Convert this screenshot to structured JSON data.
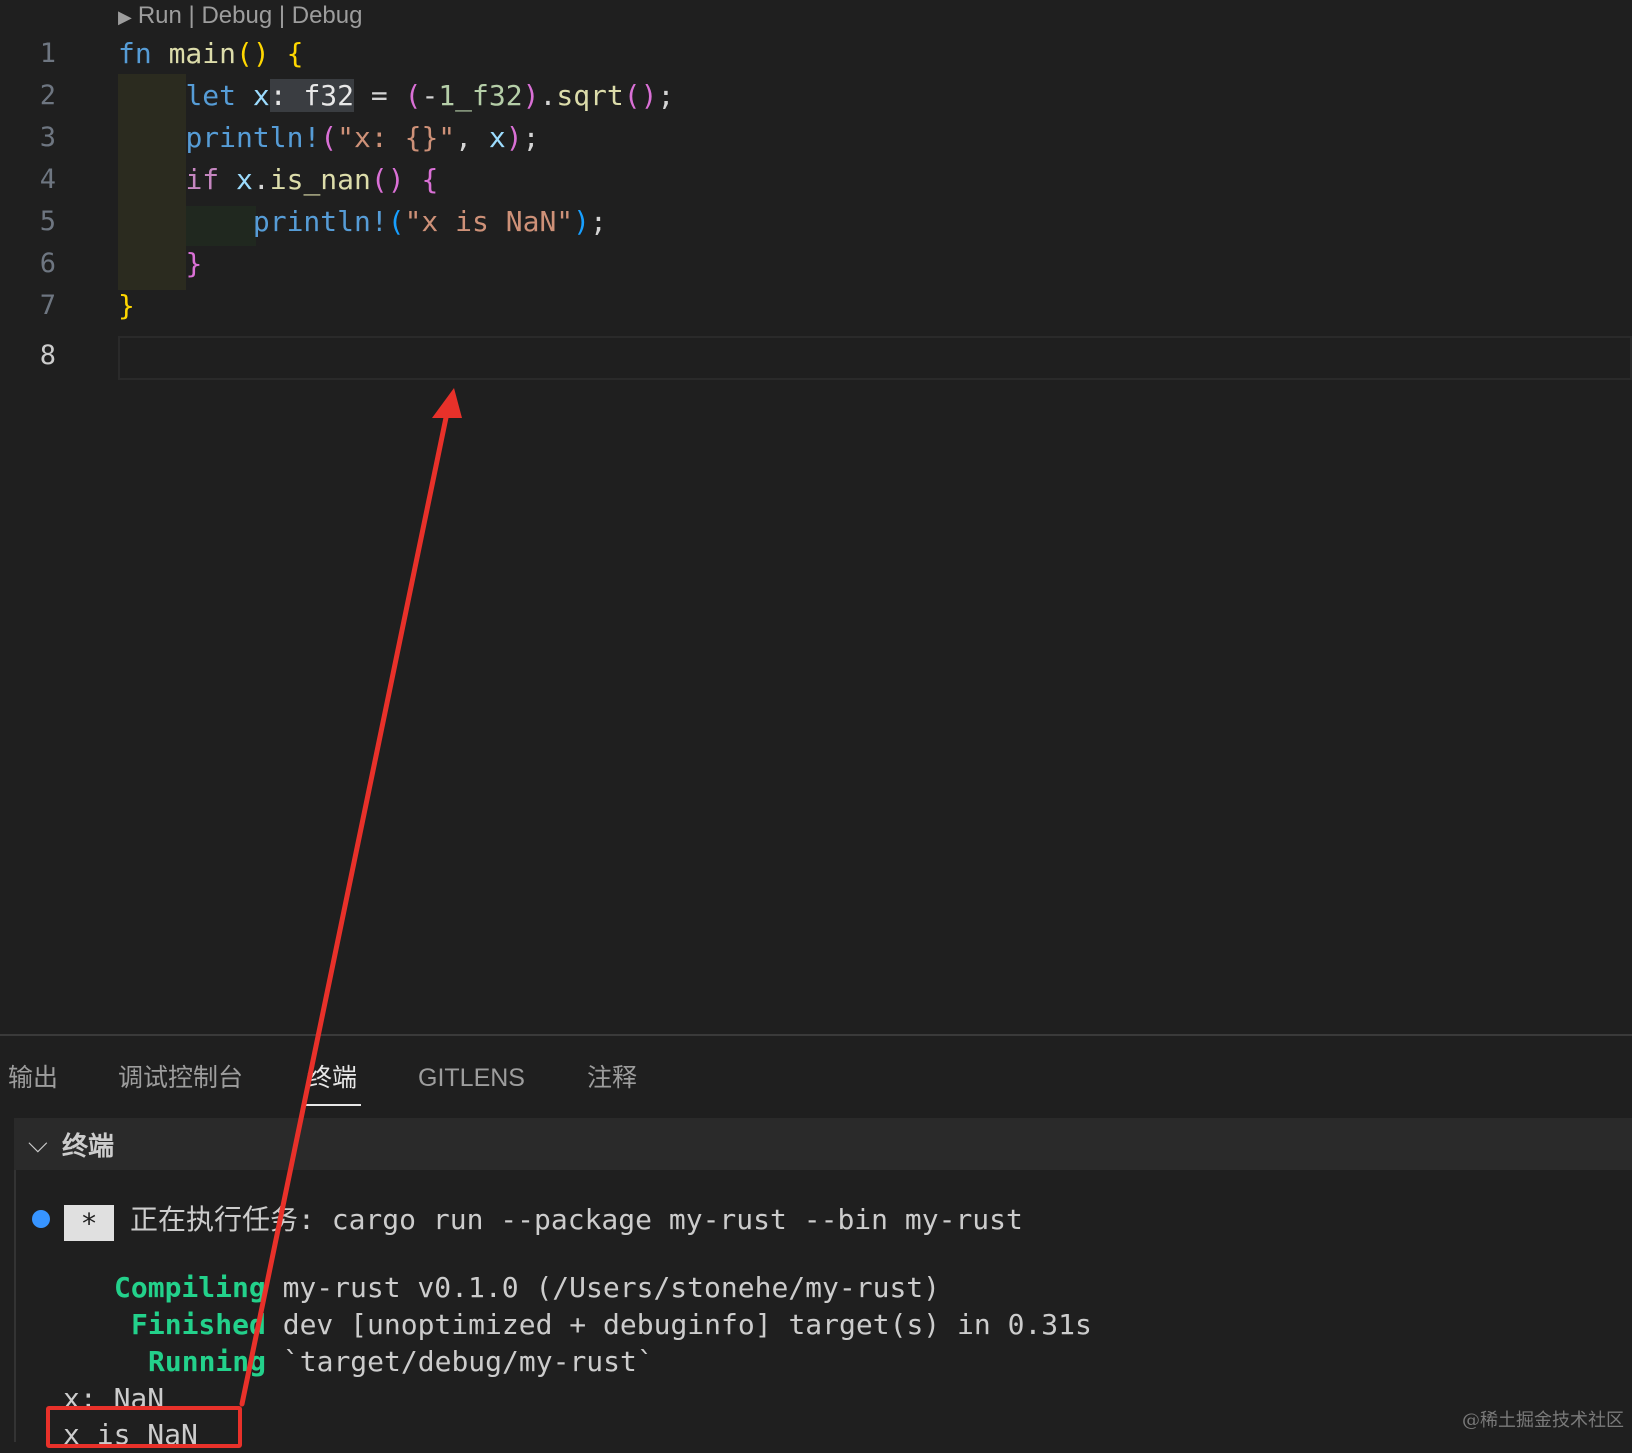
{
  "editor": {
    "codelens": "Run | Debug | Debug",
    "line_numbers": [
      "1",
      "2",
      "3",
      "4",
      "5",
      "6",
      "7",
      "8"
    ],
    "lines": [
      [
        [
          "kw",
          "fn"
        ],
        [
          "plain",
          " "
        ],
        [
          "fn",
          "main"
        ],
        [
          "b1",
          "()"
        ],
        [
          "plain",
          " "
        ],
        [
          "b1",
          "{"
        ]
      ],
      [
        [
          "plain",
          "    "
        ],
        [
          "kw",
          "let"
        ],
        [
          "plain",
          " "
        ],
        [
          "var",
          "x"
        ],
        [
          "type",
          ": f32"
        ],
        [
          "plain",
          " = "
        ],
        [
          "b2",
          "("
        ],
        [
          "plain",
          "-"
        ],
        [
          "num",
          "1_f32"
        ],
        [
          "b2",
          ")"
        ],
        [
          "plain",
          "."
        ],
        [
          "fn",
          "sqrt"
        ],
        [
          "b2",
          "()"
        ],
        [
          "plain",
          ";"
        ]
      ],
      [
        [
          "plain",
          "    "
        ],
        [
          "mac",
          "println!"
        ],
        [
          "b2",
          "("
        ],
        [
          "str",
          "\"x: {}\""
        ],
        [
          "plain",
          ", "
        ],
        [
          "var",
          "x"
        ],
        [
          "b2",
          ")"
        ],
        [
          "plain",
          ";"
        ]
      ],
      [
        [
          "plain",
          "    "
        ],
        [
          "kw2",
          "if"
        ],
        [
          "plain",
          " "
        ],
        [
          "var",
          "x"
        ],
        [
          "plain",
          "."
        ],
        [
          "fn",
          "is_nan"
        ],
        [
          "b2",
          "()"
        ],
        [
          "plain",
          " "
        ],
        [
          "b2",
          "{"
        ]
      ],
      [
        [
          "plain",
          "        "
        ],
        [
          "mac",
          "println!"
        ],
        [
          "b3",
          "("
        ],
        [
          "str",
          "\"x is NaN\""
        ],
        [
          "b3",
          ")"
        ],
        [
          "plain",
          ";"
        ]
      ],
      [
        [
          "plain",
          "    "
        ],
        [
          "b2",
          "}"
        ]
      ],
      [
        [
          "b1",
          "}"
        ]
      ],
      [
        [
          "plain",
          ""
        ]
      ]
    ]
  },
  "panel": {
    "tabs": [
      "输出",
      "调试控制台",
      "终端",
      "GITLENS",
      "注释"
    ],
    "active_tab": "终端",
    "terminal_header": "终端",
    "task_star": "*",
    "task_line": "正在执行任务: cargo run --package my-rust --bin my-rust",
    "compile": {
      "compiling_label": "Compiling",
      "compiling_text": " my-rust v0.1.0 (/Users/stonehe/my-rust)",
      "finished_label": "Finished",
      "finished_text": " dev [unoptimized + debuginfo] target(s) in 0.31s",
      "running_label": "Running",
      "running_text": " `target/debug/my-rust`"
    },
    "output": [
      "x: NaN",
      "x is NaN"
    ]
  },
  "watermark": "@稀土掘金技术社区",
  "colors": {
    "annotation": "#e8312a",
    "accent": "#3794ff",
    "success": "#23d18b"
  }
}
